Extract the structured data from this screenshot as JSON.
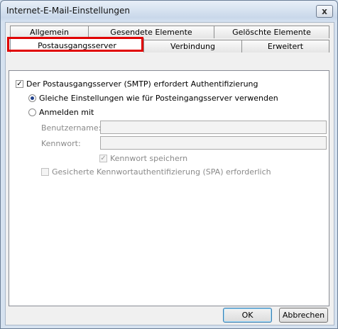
{
  "window": {
    "title": "Internet-E-Mail-Einstellungen",
    "close_symbol": "x"
  },
  "tabs_back": [
    "Allgemein",
    "Gesendete Elemente",
    "Gelöschte Elemente"
  ],
  "tabs_front": [
    "Postausgangsserver",
    "Verbindung",
    "Erweitert"
  ],
  "active_tab": "Postausgangsserver",
  "highlight_color": "#e00000",
  "smtp_auth": {
    "label": "Der Postausgangsserver (SMTP) erfordert Authentifizierung",
    "checked": true
  },
  "radio_same": {
    "label": "Gleiche Einstellungen wie für Posteingangsserver verwenden",
    "selected": true
  },
  "radio_login": {
    "label": "Anmelden mit",
    "selected": false
  },
  "username": {
    "label": "Benutzername:",
    "value": ""
  },
  "password": {
    "label": "Kennwort:",
    "value": ""
  },
  "save_password": {
    "label": "Kennwort speichern",
    "checked": true,
    "disabled": true
  },
  "spa": {
    "label": "Gesicherte Kennwortauthentifizierung (SPA) erforderlich",
    "checked": false,
    "disabled": true
  },
  "buttons": {
    "ok": "OK",
    "cancel": "Abbrechen"
  }
}
